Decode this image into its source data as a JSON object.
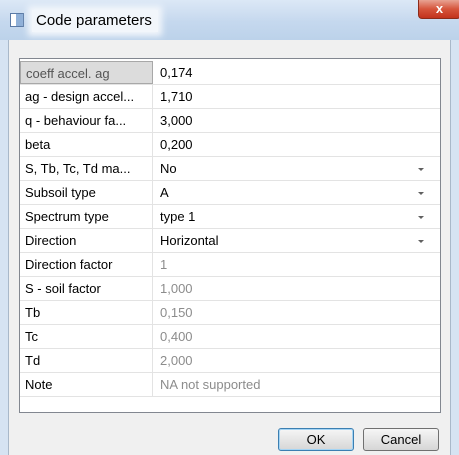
{
  "window": {
    "title": "Code parameters",
    "close_label": "x"
  },
  "params": [
    {
      "label": "coeff accel. ag",
      "value": "0,174",
      "readonly": false,
      "dropdown": false,
      "selected": true
    },
    {
      "label": "ag - design accel...",
      "value": "1,710",
      "readonly": false,
      "dropdown": false,
      "selected": false
    },
    {
      "label": "q - behaviour fa...",
      "value": "3,000",
      "readonly": false,
      "dropdown": false,
      "selected": false
    },
    {
      "label": "beta",
      "value": "0,200",
      "readonly": false,
      "dropdown": false,
      "selected": false
    },
    {
      "label": "S, Tb, Tc, Td ma...",
      "value": "No",
      "readonly": false,
      "dropdown": true,
      "selected": false
    },
    {
      "label": "Subsoil type",
      "value": "A",
      "readonly": false,
      "dropdown": true,
      "selected": false
    },
    {
      "label": "Spectrum type",
      "value": "type 1",
      "readonly": false,
      "dropdown": true,
      "selected": false
    },
    {
      "label": "Direction",
      "value": "Horizontal",
      "readonly": false,
      "dropdown": true,
      "selected": false
    },
    {
      "label": "Direction factor",
      "value": "1",
      "readonly": true,
      "dropdown": false,
      "selected": false
    },
    {
      "label": "S - soil factor",
      "value": "1,000",
      "readonly": true,
      "dropdown": false,
      "selected": false
    },
    {
      "label": "Tb",
      "value": "0,150",
      "readonly": true,
      "dropdown": false,
      "selected": false
    },
    {
      "label": "Tc",
      "value": "0,400",
      "readonly": true,
      "dropdown": false,
      "selected": false
    },
    {
      "label": "Td",
      "value": "2,000",
      "readonly": true,
      "dropdown": false,
      "selected": false
    },
    {
      "label": "Note",
      "value": "NA not supported",
      "readonly": true,
      "dropdown": false,
      "selected": false
    }
  ],
  "buttons": {
    "ok": "OK",
    "cancel": "Cancel"
  }
}
